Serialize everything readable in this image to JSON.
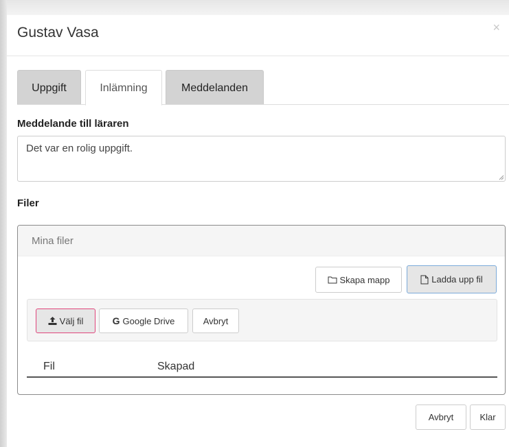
{
  "dialog": {
    "title": "Gustav Vasa",
    "close_label": "×"
  },
  "tabs": [
    {
      "label": "Uppgift",
      "active": false
    },
    {
      "label": "Inlämning",
      "active": true
    },
    {
      "label": "Meddelanden",
      "active": false
    }
  ],
  "message": {
    "label": "Meddelande till läraren",
    "value": "Det var en rolig uppgift."
  },
  "files": {
    "label": "Filer",
    "panel_title": "Mina filer",
    "create_folder_label": "Skapa mapp",
    "upload_file_label": "Ladda upp fil",
    "upload": {
      "choose_file_label": "Välj fil",
      "google_drive_label": "Google Drive",
      "cancel_label": "Avbryt"
    },
    "table": {
      "columns": [
        "Fil",
        "Skapad"
      ]
    }
  },
  "footer": {
    "cancel_label": "Avbryt",
    "done_label": "Klar"
  },
  "colors": {
    "tab_inactive": "#d3d3d3",
    "choose_file_border": "#e0457b",
    "upload_border": "#7aa9d9"
  }
}
